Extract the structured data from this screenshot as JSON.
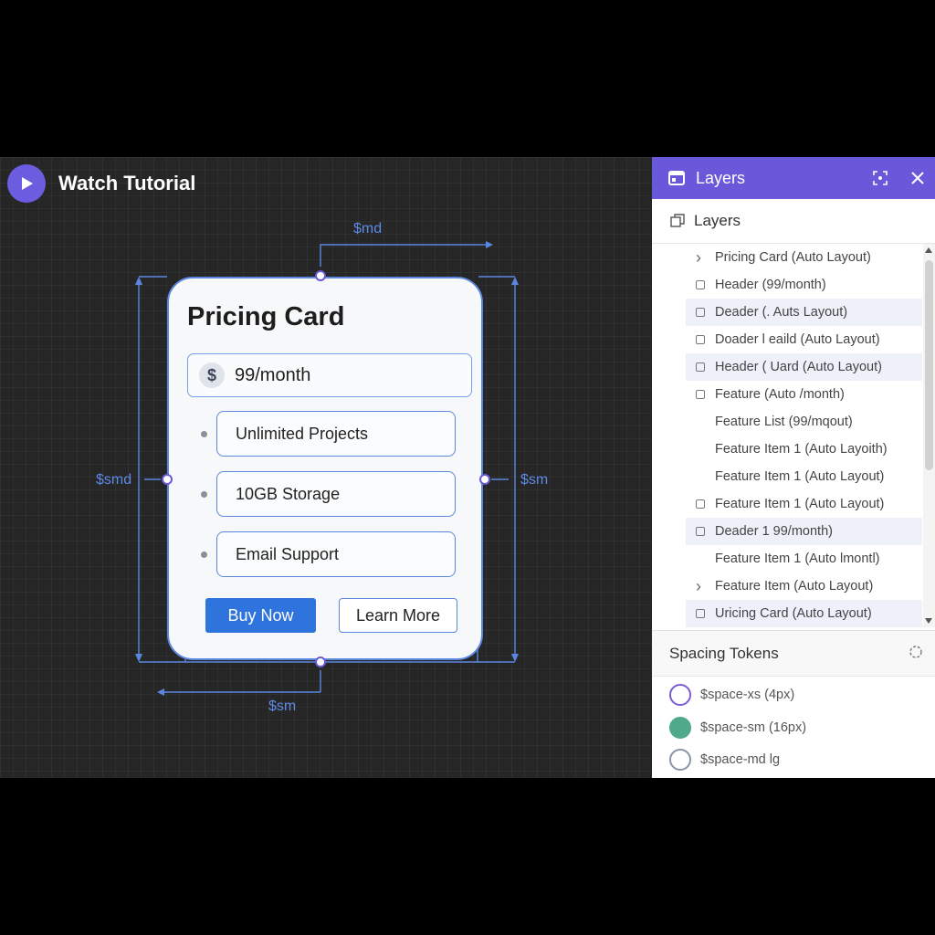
{
  "tutorial": {
    "label": "Watch Tutorial",
    "icon": "play-icon"
  },
  "measurements": {
    "top": "$md",
    "left": "$smd",
    "right": "$sm",
    "bottom": "$sm"
  },
  "card": {
    "title": "Pricing Card",
    "price": {
      "symbol": "$",
      "text": "99/month"
    },
    "features": [
      "Unlimited Projects",
      "10GB Storage",
      "Email Support"
    ],
    "primary_button": "Buy Now",
    "secondary_button": "Learn More"
  },
  "panel": {
    "title": "Layers",
    "layers_subtitle": "Layers",
    "layers": [
      {
        "label": "Pricing Card (Auto Layout)",
        "icon": "chevron-right",
        "selected": false
      },
      {
        "label": "Header (99/month)",
        "icon": "frame",
        "selected": false
      },
      {
        "label": "Deader (. Auts Layout)",
        "icon": "frame",
        "selected": true
      },
      {
        "label": "Doader l eaild (Auto Layout)",
        "icon": "frame",
        "selected": false
      },
      {
        "label": "Header ( Uard (Auto Layout)",
        "icon": "frame",
        "selected": true
      },
      {
        "label": "Feature (Auto /month)",
        "icon": "frame",
        "selected": false
      },
      {
        "label": "Feature List (99/mqout)",
        "icon": "none",
        "selected": false
      },
      {
        "label": "Feature Item 1 (Auto Layoith)",
        "icon": "none",
        "selected": false
      },
      {
        "label": "Feature Item 1 (Auto Layout)",
        "icon": "none",
        "selected": false
      },
      {
        "label": "Feature Item 1 (Auto Layout)",
        "icon": "frame",
        "selected": false
      },
      {
        "label": "Deader 1 99/month)",
        "icon": "frame",
        "selected": true
      },
      {
        "label": "Feature Item 1 (Auto lmontl)",
        "icon": "none",
        "selected": false
      },
      {
        "label": "Feature Item (Auto Layout)",
        "icon": "chevron-right",
        "selected": false
      },
      {
        "label": "Uricing Card (Auto Layout)",
        "icon": "frame",
        "selected": true
      }
    ],
    "tokens_title": "Spacing Tokens",
    "tokens": [
      {
        "label": "$space-xs (4px)",
        "fill": "#ffffff",
        "border": "#7b5cd6"
      },
      {
        "label": "$space-sm (16px)",
        "fill": "#4fa98a",
        "border": "#4fa98a"
      },
      {
        "label": "$space-md lg",
        "fill": "#ffffff",
        "border": "#8a93ad"
      }
    ]
  },
  "colors": {
    "accent": "#6a58db",
    "guide": "#5b87e0",
    "primary_button": "#2f73dc"
  }
}
